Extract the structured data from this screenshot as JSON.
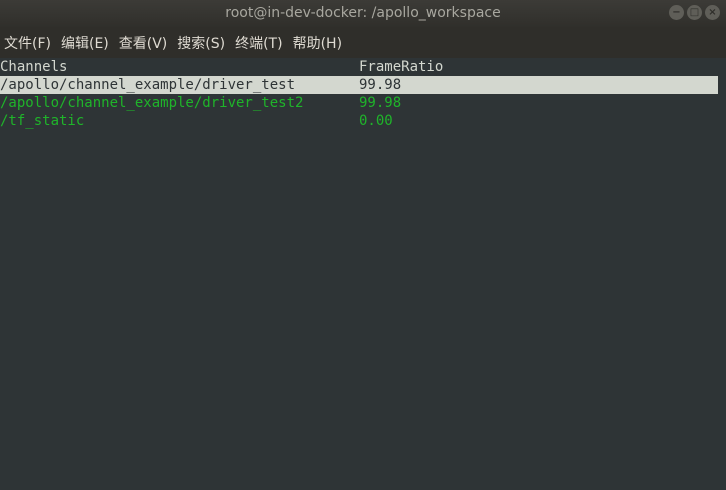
{
  "window": {
    "title": "root@in-dev-docker: /apollo_workspace",
    "buttons": {
      "minimize": "−",
      "maximize": "□",
      "close": "×"
    }
  },
  "menubar": {
    "items": [
      {
        "label": "文件(F)"
      },
      {
        "label": "编辑(E)"
      },
      {
        "label": "查看(V)"
      },
      {
        "label": "搜索(S)"
      },
      {
        "label": "终端(T)"
      },
      {
        "label": "帮助(H)"
      }
    ]
  },
  "terminal": {
    "headers": {
      "channels": "Channels",
      "frame_ratio": "FrameRatio"
    },
    "rows": [
      {
        "channel": "/apollo/channel_example/driver_test",
        "frame_ratio": "99.98",
        "selected": true
      },
      {
        "channel": "/apollo/channel_example/driver_test2",
        "frame_ratio": "99.98",
        "selected": false
      },
      {
        "channel": "/tf_static",
        "frame_ratio": "0.00",
        "selected": false
      }
    ],
    "colors": {
      "background": "#2e3436",
      "highlight": "#d3d7cf",
      "active_text": "#1fb42a"
    }
  }
}
